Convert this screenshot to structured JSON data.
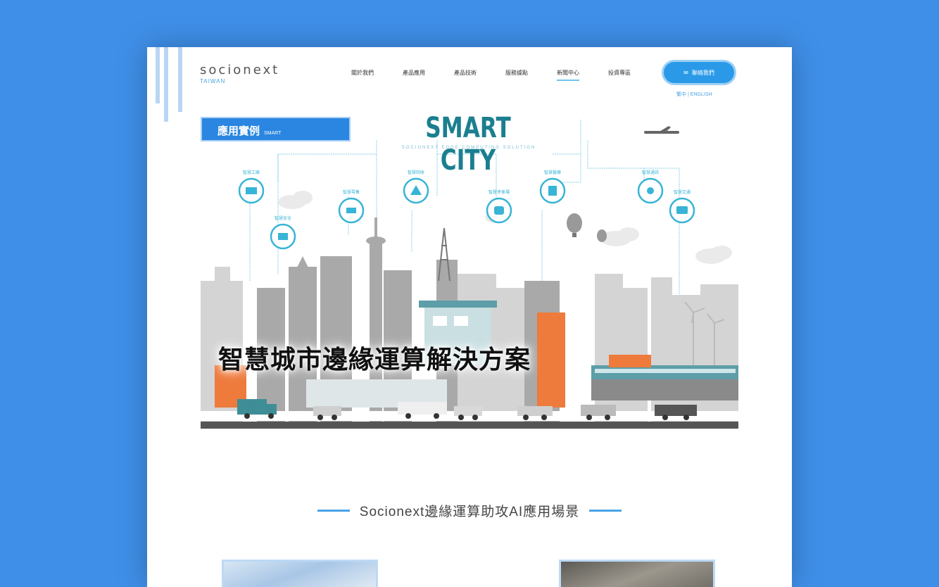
{
  "header": {
    "logo": "socionext",
    "logo_sub": "TAIWAN",
    "nav": [
      {
        "label": "關於我們",
        "active": false
      },
      {
        "label": "產品應用",
        "active": false
      },
      {
        "label": "產品技術",
        "active": false
      },
      {
        "label": "服務據點",
        "active": false
      },
      {
        "label": "新聞中心",
        "active": true
      },
      {
        "label": "投資專區",
        "active": false
      }
    ],
    "contact_button": "聯絡我們",
    "sub_link": "繁中 | ENGLISH"
  },
  "hero": {
    "badge": "應用實例",
    "badge_small": "SMART",
    "title": "SMART CITY",
    "subtitle": "SOCIONEXT EDGE COMPUTING SOLUTION",
    "headline": "智慧城市邊緣運算解決方案",
    "icon_labels": [
      "智慧工廠",
      "智慧安全",
      "智慧零售",
      "智慧回收",
      "智慧停車場",
      "智慧醫療",
      "智慧通訊",
      "智慧交通"
    ]
  },
  "section": {
    "title": "Socionext邊緣運算助攻AI應用場景"
  },
  "colors": {
    "background": "#3f8fe8",
    "accent": "#2a9ae8",
    "teal": "#1b7f8f"
  }
}
